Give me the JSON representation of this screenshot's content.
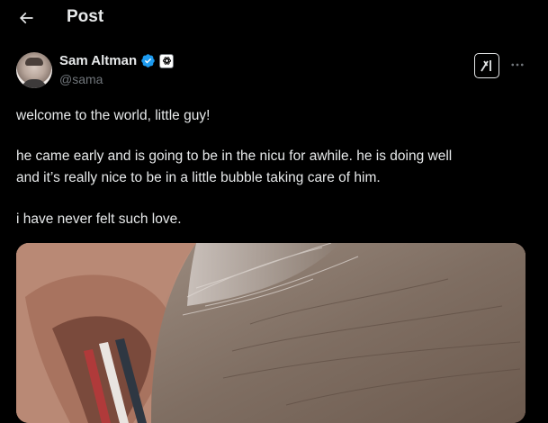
{
  "header": {
    "title": "Post",
    "back_icon": "arrow-left-icon"
  },
  "author": {
    "name": "Sam Altman",
    "handle": "@sama",
    "verified_icon": "verified-badge-icon",
    "verified_color": "#1d9bf0",
    "affiliation_icon": "openai-logo-icon",
    "avatar_icon": "profile-avatar"
  },
  "actions": {
    "grok_icon": "grok-icon",
    "more_icon": "more-horizontal-icon"
  },
  "tweet": {
    "lines": [
      "welcome to the world, little guy!",
      "he came early and is going to be in the nicu for awhile. he is doing well",
      "and it’s really nice to be in a little bubble taking care of him.",
      "i have never felt such love."
    ]
  },
  "media": {
    "kind": "photo"
  },
  "colors": {
    "background": "#000000",
    "text": "#e7e9ea",
    "secondary_text": "#71767b",
    "verified": "#1d9bf0"
  }
}
